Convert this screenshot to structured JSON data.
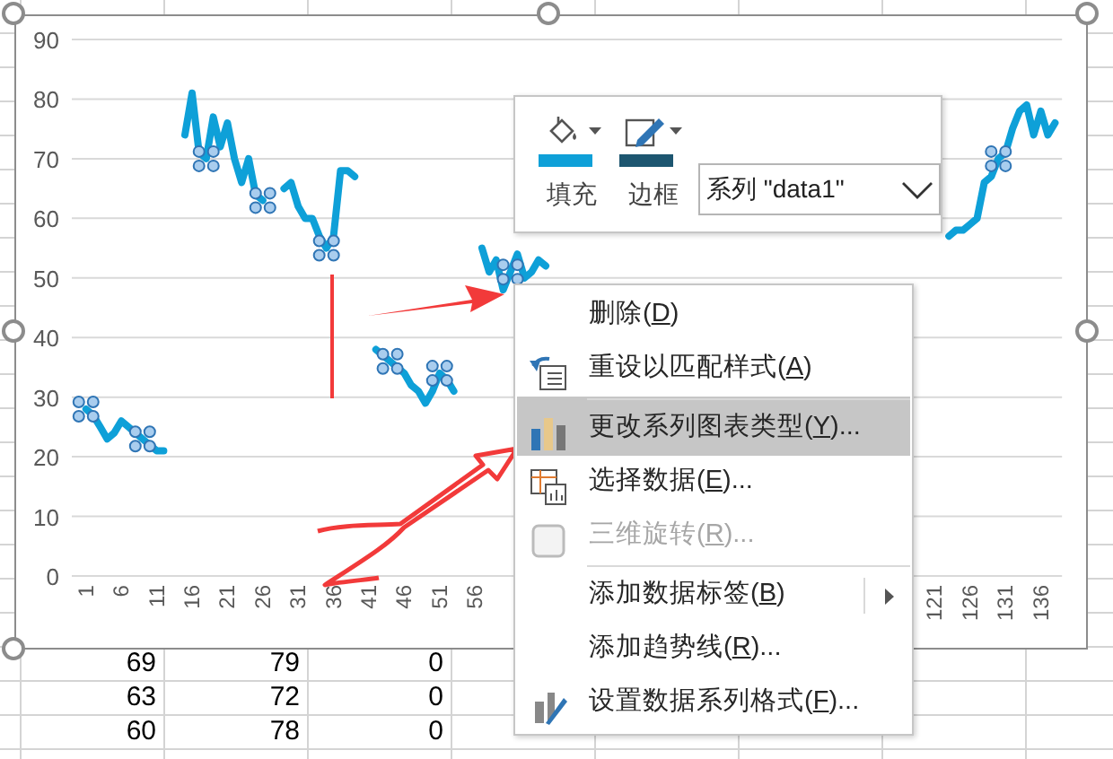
{
  "chart": {
    "chart_data": {
      "type": "line",
      "grid": true,
      "xlim": [
        -1,
        139
      ],
      "ylim": [
        0,
        90
      ],
      "yticks": [
        0,
        10,
        20,
        30,
        40,
        50,
        60,
        70,
        80,
        90
      ],
      "xticks": [
        1,
        6,
        11,
        16,
        21,
        26,
        31,
        36,
        41,
        46,
        51,
        56,
        121,
        126,
        131,
        136
      ],
      "x": [
        1,
        2,
        3,
        4,
        5,
        6,
        7,
        8,
        9,
        10,
        11,
        12,
        13,
        15,
        16,
        17,
        18,
        19,
        20,
        21,
        22,
        23,
        24,
        25,
        26,
        27,
        29,
        30,
        31,
        32,
        33,
        34,
        35,
        36,
        37,
        38,
        39,
        40,
        42,
        43,
        44,
        45,
        46,
        47,
        48,
        49,
        50,
        51,
        52,
        53,
        54,
        57,
        58,
        59,
        60,
        61,
        62,
        63,
        64,
        65,
        66,
        67,
        123,
        124,
        125,
        126,
        127,
        128,
        129,
        130,
        131,
        132,
        133,
        134,
        135,
        136,
        137,
        138
      ],
      "series": [
        {
          "color": "#0ea0d8",
          "values": [
            28,
            27,
            25,
            23,
            24,
            26,
            25,
            24,
            23,
            22,
            21,
            21,
            null,
            74,
            81,
            71,
            70,
            77,
            72,
            76,
            70,
            66,
            70,
            64,
            63,
            null,
            65,
            66,
            62,
            60,
            60,
            57,
            55,
            57,
            68,
            68,
            67,
            null,
            38,
            37,
            36,
            35,
            34,
            32,
            31,
            29,
            31,
            34,
            33,
            31,
            null,
            55,
            51,
            53,
            48,
            51,
            54,
            50,
            51,
            53,
            52,
            null,
            57,
            58,
            58,
            59,
            60,
            66,
            67,
            70,
            71,
            75,
            78,
            79,
            74,
            78,
            74,
            76
          ]
        }
      ]
    },
    "series_selected": true
  },
  "sheet_rows": [
    [
      "69",
      "79",
      "0"
    ],
    [
      "63",
      "72",
      "0"
    ],
    [
      "60",
      "78",
      "0"
    ]
  ],
  "format_toolbar": {
    "buttons": [
      {
        "label": "填充",
        "color": "#0ea0d8"
      },
      {
        "label": "边框",
        "color": "#1d5670"
      }
    ],
    "series_dropdown": {
      "value": "系列 \"data1\""
    }
  },
  "context_menu": [
    {
      "text": "删除(",
      "key": "D",
      "after": ")",
      "selected": false,
      "disabled": false,
      "submenu": false,
      "divider_above": false
    },
    {
      "text": "重设以匹配样式(",
      "key": "A",
      "after": ")",
      "selected": false,
      "disabled": false,
      "submenu": false,
      "divider_above": false
    },
    {
      "text": "更改系列图表类型(",
      "key": "Y",
      "after": ")...",
      "selected": true,
      "disabled": false,
      "submenu": false,
      "divider_above": true
    },
    {
      "text": "选择数据(",
      "key": "E",
      "after": ")...",
      "selected": false,
      "disabled": false,
      "submenu": false,
      "divider_above": false
    },
    {
      "text": "三维旋转(",
      "key": "R",
      "after": ")...",
      "selected": false,
      "disabled": true,
      "submenu": false,
      "divider_above": false
    },
    {
      "text": "添加数据标签(",
      "key": "B",
      "after": ")",
      "selected": false,
      "disabled": false,
      "submenu": true,
      "divider_above": true
    },
    {
      "text": "添加趋势线(",
      "key": "R",
      "after": ")...",
      "selected": false,
      "disabled": false,
      "submenu": false,
      "divider_above": false
    },
    {
      "text": "设置数据系列格式(",
      "key": "F",
      "after": ")...",
      "selected": false,
      "disabled": false,
      "submenu": false,
      "divider_above": false
    }
  ]
}
